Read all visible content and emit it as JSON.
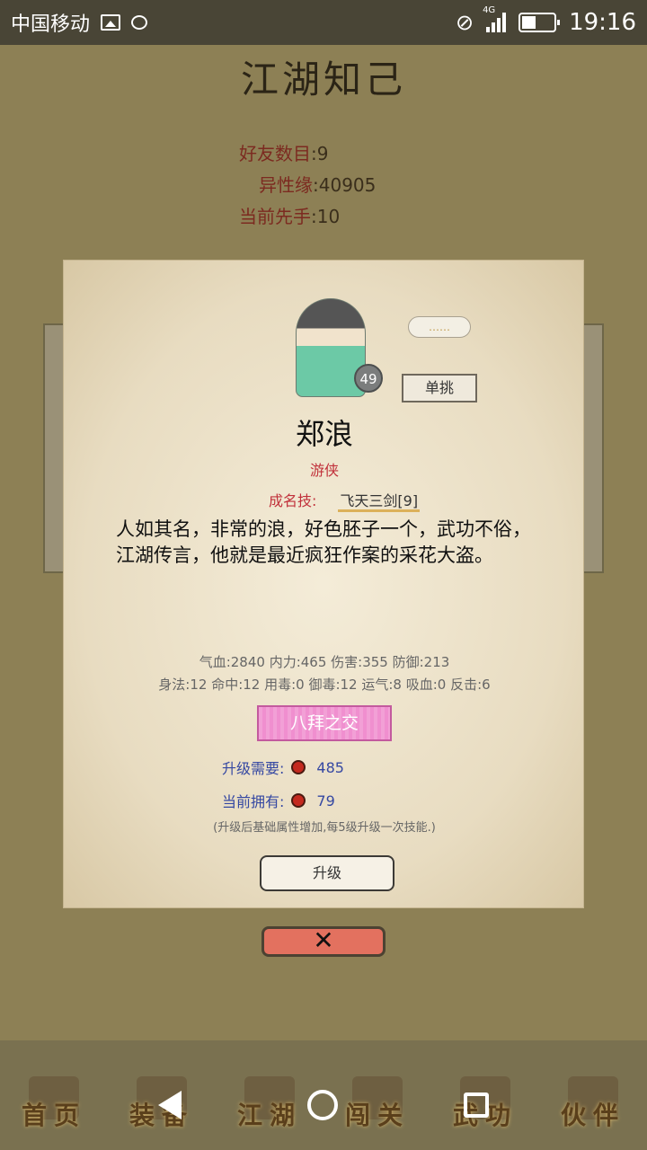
{
  "status_bar": {
    "carrier": "中国移动",
    "network": "4G",
    "time": "19:16",
    "icons": [
      "image-icon",
      "chat-icon",
      "mute-icon",
      "signal-icon",
      "battery-icon"
    ]
  },
  "page_title": "江湖知己",
  "top_stats": [
    {
      "label": "好友数目",
      "value": ":9"
    },
    {
      "label": "异性缘",
      "value": ":40905"
    },
    {
      "label": "当前先手",
      "value": ":10"
    }
  ],
  "dialog": {
    "speech_bubble": "……",
    "level": "49",
    "duel_button": "单挑",
    "name": "郑浪",
    "class": "游侠",
    "signature_skill_label": "成名技:",
    "signature_skill_value": "飞天三剑[9]",
    "description": "人如其名，非常的浪，好色胚子一个，武功不俗，江湖传言，他就是最近疯狂作案的采花大盗。",
    "attributes_line1": "气血:2840  内力:465  伤害:355  防御:213",
    "attributes_line2": "身法:12  命中:12  用毒:0  御毒:12  运气:8  吸血:0  反击:6",
    "bond_button": "八拜之交",
    "upgrade_need_label": "升级需要:",
    "upgrade_need_value": "485",
    "current_have_label": "当前拥有:",
    "current_have_value": "79",
    "note": "(升级后基础属性增加,每5级升级一次技能.)",
    "upgrade_button": "升级",
    "close_button": "✕"
  },
  "tabs": [
    {
      "label": "首页",
      "icon": "house-icon"
    },
    {
      "label": "装备",
      "icon": "armor-icon"
    },
    {
      "label": "江湖",
      "icon": "scroll-icon"
    },
    {
      "label": "闯关",
      "icon": "swords-icon"
    },
    {
      "label": "武功",
      "icon": "book-icon"
    },
    {
      "label": "伙伴",
      "icon": "partners-icon"
    }
  ],
  "colors": {
    "background": "#8d8055",
    "dialog_bg": "#ece2cc",
    "accent_red": "#c1313b",
    "accent_blue": "#3548a2",
    "bond_pink": "#f08fcf"
  }
}
